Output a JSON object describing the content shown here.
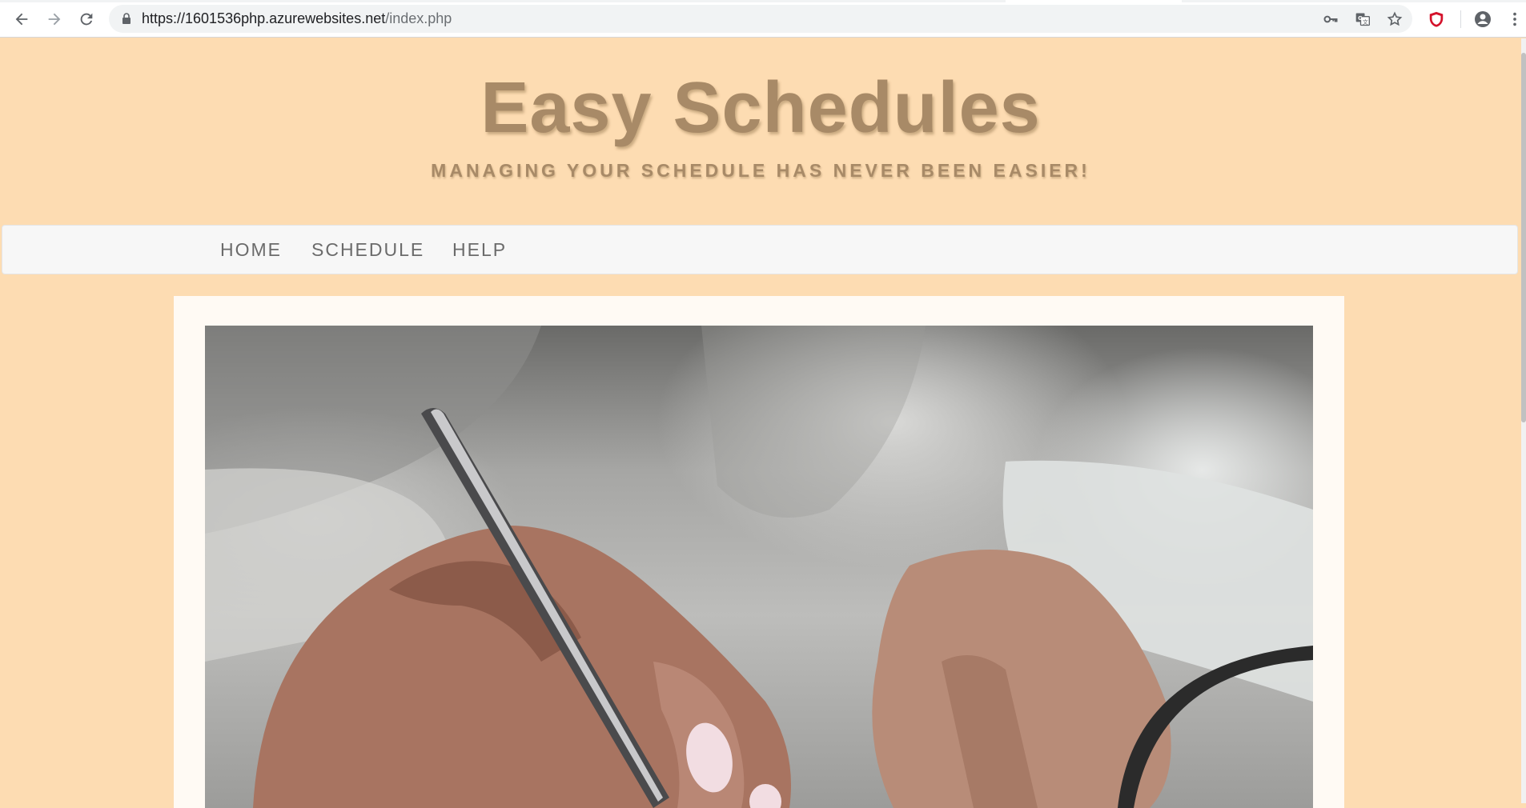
{
  "browser": {
    "url_host": "https://1601536php.azurewebsites.net",
    "url_path": "/index.php"
  },
  "site": {
    "title": "Easy Schedules",
    "subtitle": "MANAGING YOUR SCHEDULE HAS NEVER BEEN EASIER!"
  },
  "nav": {
    "items": [
      {
        "label": "HOME"
      },
      {
        "label": "SCHEDULE"
      },
      {
        "label": "HELP"
      }
    ]
  },
  "icons": {
    "back": "arrow-left-icon",
    "forward": "arrow-right-icon",
    "reload": "reload-icon",
    "lock": "lock-icon",
    "key": "key-icon",
    "translate": "translate-icon",
    "bookmark": "star-icon",
    "extension": "shield-icon",
    "profile": "account-circle-icon",
    "menu": "kebab-menu-icon"
  },
  "colors": {
    "page_background": "#fddcb2",
    "title": "#a88a67",
    "navbar": "#f7f7f7",
    "card": "#fffaf4",
    "extension_red": "#d4122b"
  }
}
